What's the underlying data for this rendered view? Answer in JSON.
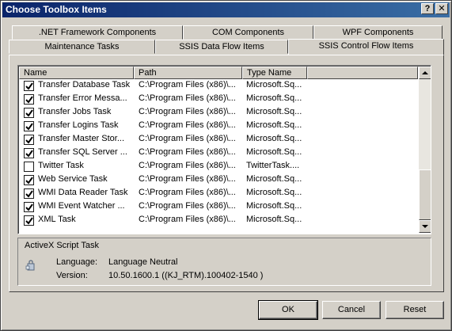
{
  "window": {
    "title": "Choose Toolbox Items",
    "help_glyph": "?",
    "close_glyph": "✕"
  },
  "tabs": {
    "top_row": [
      ".NET Framework Components",
      "COM Components",
      "WPF Components"
    ],
    "bottom_row": [
      "Maintenance Tasks",
      "SSIS Data Flow Items",
      "SSIS Control Flow Items"
    ],
    "active": "SSIS Control Flow Items"
  },
  "list": {
    "columns": [
      "Name",
      "Path",
      "Type Name"
    ],
    "rows": [
      {
        "checked": true,
        "name": "Transfer Database Task",
        "path": "C:\\Program Files (x86)\\...",
        "type": "Microsoft.Sq..."
      },
      {
        "checked": true,
        "name": "Transfer Error Messa...",
        "path": "C:\\Program Files (x86)\\...",
        "type": "Microsoft.Sq..."
      },
      {
        "checked": true,
        "name": "Transfer Jobs Task",
        "path": "C:\\Program Files (x86)\\...",
        "type": "Microsoft.Sq..."
      },
      {
        "checked": true,
        "name": "Transfer Logins Task",
        "path": "C:\\Program Files (x86)\\...",
        "type": "Microsoft.Sq..."
      },
      {
        "checked": true,
        "name": "Transfer Master Stor...",
        "path": "C:\\Program Files (x86)\\...",
        "type": "Microsoft.Sq..."
      },
      {
        "checked": true,
        "name": "Transfer SQL Server ...",
        "path": "C:\\Program Files (x86)\\...",
        "type": "Microsoft.Sq..."
      },
      {
        "checked": false,
        "name": "Twitter Task",
        "path": "C:\\Program Files (x86)\\...",
        "type": "TwitterTask...."
      },
      {
        "checked": true,
        "name": "Web Service Task",
        "path": "C:\\Program Files (x86)\\...",
        "type": "Microsoft.Sq..."
      },
      {
        "checked": true,
        "name": "WMI Data Reader Task",
        "path": "C:\\Program Files (x86)\\...",
        "type": "Microsoft.Sq..."
      },
      {
        "checked": true,
        "name": "WMI Event Watcher ...",
        "path": "C:\\Program Files (x86)\\...",
        "type": "Microsoft.Sq..."
      },
      {
        "checked": true,
        "name": "XML Task",
        "path": "C:\\Program Files (x86)\\...",
        "type": "Microsoft.Sq..."
      }
    ]
  },
  "details": {
    "title": "ActiveX Script Task",
    "language_label": "Language:",
    "language_value": "Language Neutral",
    "version_label": "Version:",
    "version_value": "10.50.1600.1 ((KJ_RTM).100402-1540 )"
  },
  "buttons": {
    "ok": "OK",
    "cancel": "Cancel",
    "reset": "Reset"
  }
}
